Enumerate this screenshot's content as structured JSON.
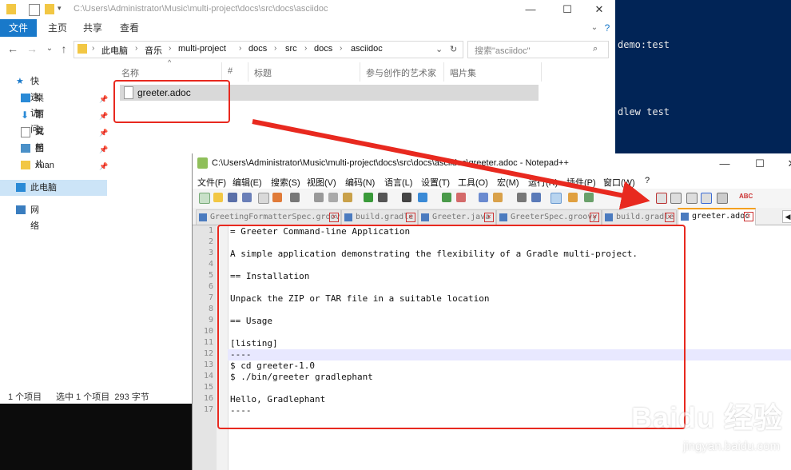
{
  "console": {
    "lines": [
      "demo:test",
      "dlew test"
    ]
  },
  "explorer": {
    "title_path": "C:\\Users\\Administrator\\Music\\multi-project\\docs\\src\\docs\\asciidoc",
    "ribbon_tabs": [
      "文件",
      "主页",
      "共享",
      "查看"
    ],
    "breadcrumb": [
      "此电脑",
      "音乐",
      "multi-project",
      "docs",
      "src",
      "docs",
      "asciidoc"
    ],
    "search_placeholder": "搜索\"asciidoc\"",
    "columns": [
      "名称",
      "#",
      "标题",
      "参与创作的艺术家",
      "唱片集"
    ],
    "nav": {
      "quick_access": "快速访问",
      "items": [
        "桌面",
        "下载",
        "文档",
        "图片",
        "xuan"
      ],
      "this_pc": "此电脑",
      "network": "网络"
    },
    "file_name": "greeter.adoc",
    "status": {
      "count": "1 个项目",
      "selected": "选中 1 个项目  293 字节"
    }
  },
  "npp": {
    "title": "C:\\Users\\Administrator\\Music\\multi-project\\docs\\src\\docs\\asciidoc\\greeter.adoc - Notepad++",
    "menus": [
      "文件(F)",
      "编辑(E)",
      "搜索(S)",
      "视图(V)",
      "编码(N)",
      "语言(L)",
      "设置(T)",
      "工具(O)",
      "宏(M)",
      "运行(R)",
      "插件(P)",
      "窗口(W)",
      "?"
    ],
    "tabs": [
      "GreetingFormatterSpec.groovy",
      "build.gradle",
      "Greeter.java",
      "GreeterSpec.groovy",
      "build.gradle",
      "greeter.adoc"
    ],
    "lines": [
      "= Greeter Command-line Application",
      "",
      "A simple application demonstrating the flexibility of a Gradle multi-project.",
      "",
      "== Installation",
      "",
      "Unpack the ZIP or TAR file in a suitable location",
      "",
      "== Usage",
      "",
      "[listing]",
      "----",
      "$ cd greeter-1.0",
      "$ ./bin/greeter gradlephant",
      "",
      "Hello, Gradlephant",
      "----"
    ]
  },
  "watermark": {
    "brand": "Baidu 经验",
    "url": "jingyan.baidu.com"
  }
}
